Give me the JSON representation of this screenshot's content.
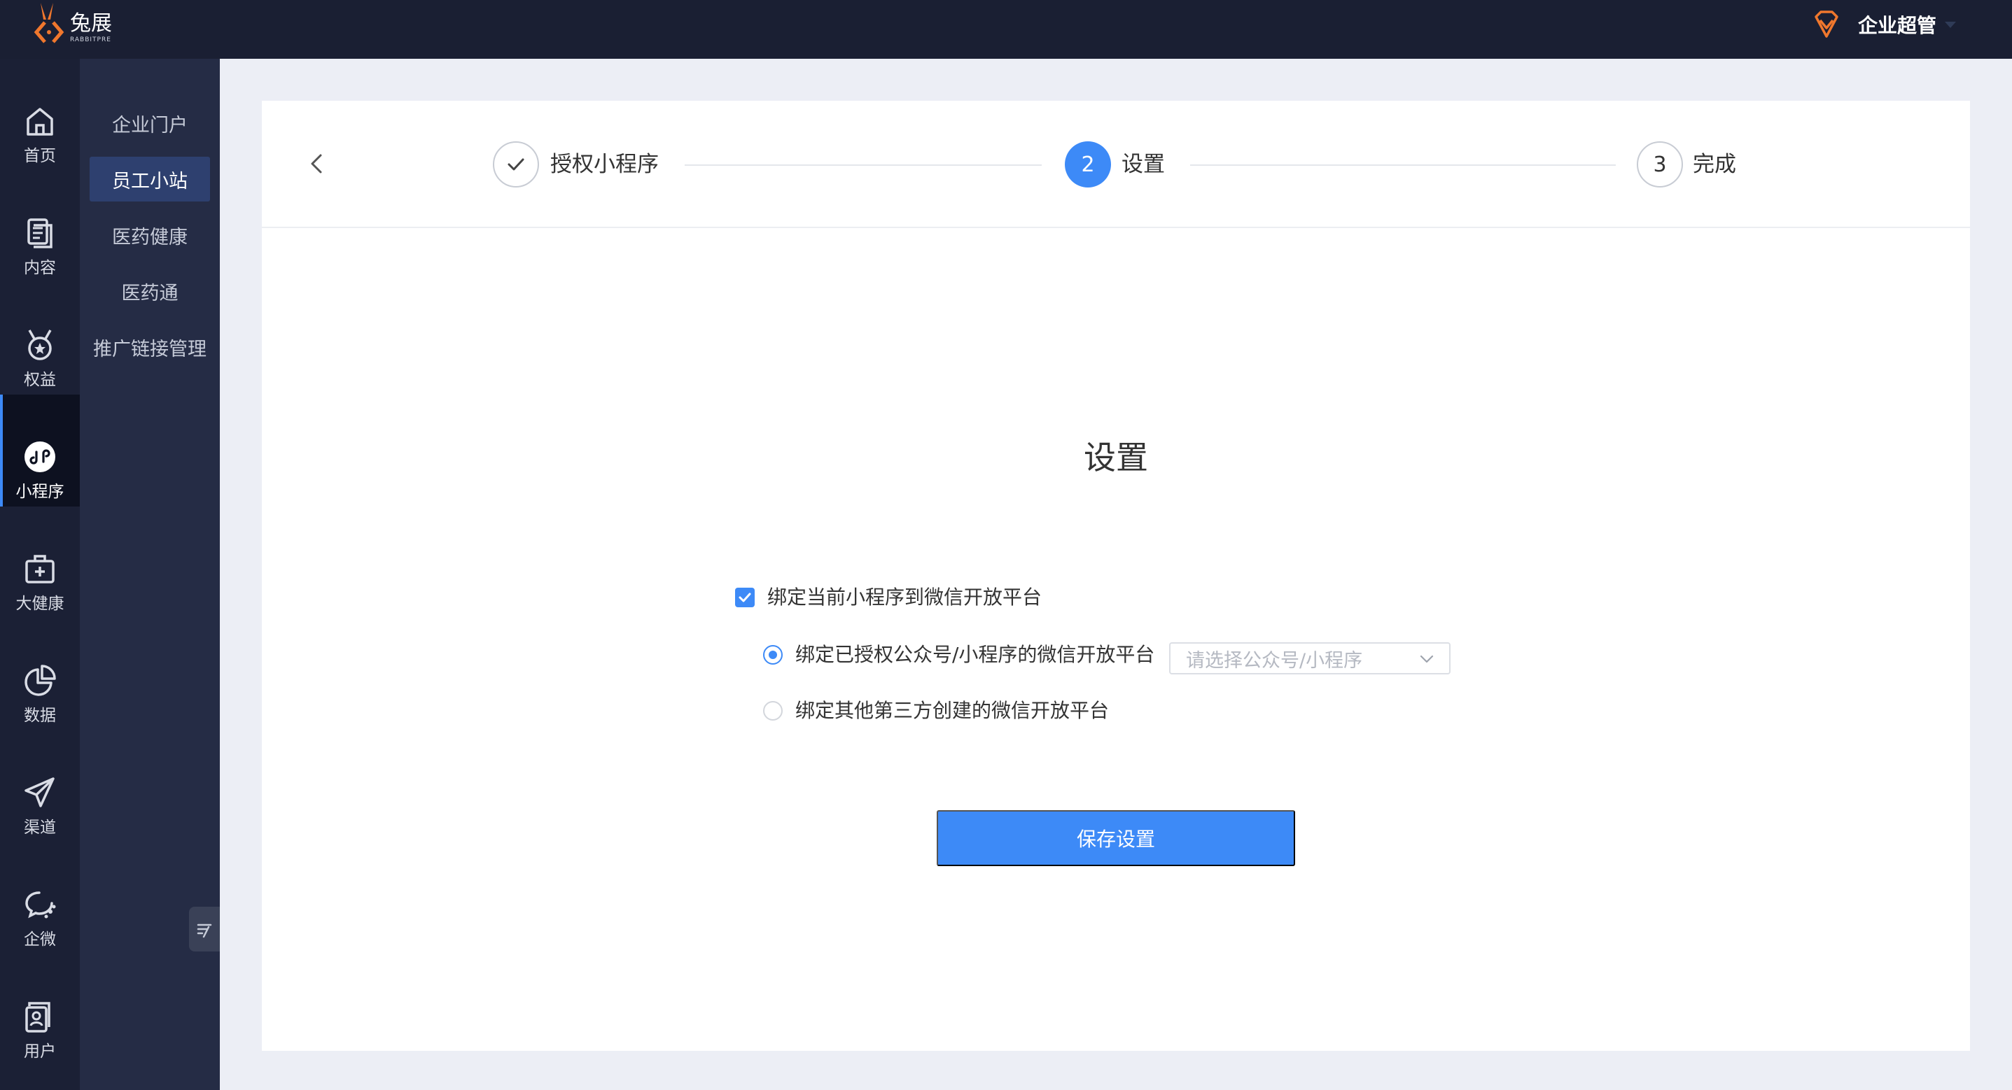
{
  "brand": {
    "name": "兔展",
    "name_en": "RABBITPRE",
    "color": "#f0772d"
  },
  "header": {
    "user_name": "企业超管",
    "accent": "#f0772d"
  },
  "rail": {
    "items": [
      {
        "label": "首页",
        "icon": "home-icon"
      },
      {
        "label": "内容",
        "icon": "document-icon"
      },
      {
        "label": "权益",
        "icon": "medal-icon"
      },
      {
        "label": "小程序",
        "icon": "mini-program-icon",
        "active": true
      },
      {
        "label": "大健康",
        "icon": "medical-kit-icon"
      },
      {
        "label": "数据",
        "icon": "pie-chart-icon"
      },
      {
        "label": "渠道",
        "icon": "send-icon"
      },
      {
        "label": "企微",
        "icon": "chat-icon"
      },
      {
        "label": "用户",
        "icon": "user-card-icon"
      }
    ]
  },
  "submenu": {
    "items": [
      {
        "label": "企业门户"
      },
      {
        "label": "员工小站",
        "active": true
      },
      {
        "label": "医药健康"
      },
      {
        "label": "医药通"
      },
      {
        "label": "推广链接管理"
      }
    ]
  },
  "steps": [
    {
      "label": "授权小程序",
      "state": "done"
    },
    {
      "number": "2",
      "label": "设置",
      "state": "current"
    },
    {
      "number": "3",
      "label": "完成",
      "state": "pending"
    }
  ],
  "form": {
    "title": "设置",
    "bind_checkbox": {
      "label": "绑定当前小程序到微信开放平台",
      "checked": true
    },
    "radio_authorized": {
      "label": "绑定已授权公众号/小程序的微信开放平台",
      "selected": true
    },
    "select": {
      "placeholder": "请选择公众号/小程序"
    },
    "radio_third_party": {
      "label": "绑定其他第三方创建的微信开放平台",
      "selected": false
    },
    "save_label": "保存设置"
  },
  "colors": {
    "primary": "#3d8af7",
    "topbar": "#1a1f33",
    "rail": "#1b2035",
    "submenu": "#252c45"
  }
}
